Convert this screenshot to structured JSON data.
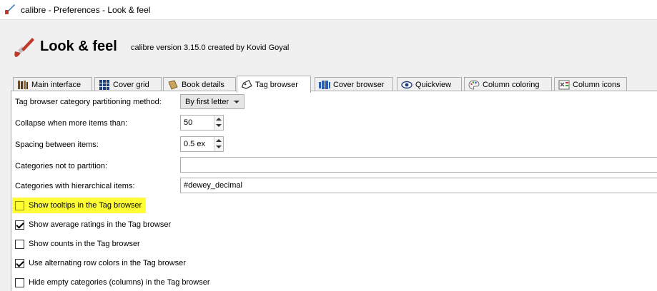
{
  "window": {
    "title": "calibre - Preferences - Look & feel"
  },
  "header": {
    "title": "Look & feel",
    "version": "calibre version 3.15.0 created by Kovid Goyal"
  },
  "tabs": [
    {
      "label": "Main interface",
      "icon": "books-icon",
      "active": false
    },
    {
      "label": "Cover grid",
      "icon": "grid-icon",
      "active": false
    },
    {
      "label": "Book details",
      "icon": "book-icon",
      "active": false
    },
    {
      "label": "Tag browser",
      "icon": "tag-icon",
      "active": true
    },
    {
      "label": "Cover browser",
      "icon": "cover-browser-icon",
      "active": false
    },
    {
      "label": "Quickview",
      "icon": "eye-icon",
      "active": false
    },
    {
      "label": "Column coloring",
      "icon": "palette-icon",
      "active": false
    },
    {
      "label": "Column icons",
      "icon": "column-icons-icon",
      "active": false
    }
  ],
  "settings": {
    "partition_label": "Tag browser category partitioning method:",
    "partition_value": "By first letter",
    "collapse_label": "Collapse when more items than:",
    "collapse_value": "50",
    "spacing_label": "Spacing between items:",
    "spacing_value": "0.5 ex",
    "not_partition_label": "Categories not to partition:",
    "not_partition_value": "",
    "hierarchical_label": "Categories with hierarchical items:",
    "hierarchical_value": "#dewey_decimal"
  },
  "checkboxes": [
    {
      "label": "Show tooltips in the Tag browser",
      "checked": false,
      "highlighted": true
    },
    {
      "label": "Show average ratings in the Tag browser",
      "checked": true,
      "highlighted": false
    },
    {
      "label": "Show counts in the Tag browser",
      "checked": false,
      "highlighted": false
    },
    {
      "label": "Use alternating row colors in the Tag browser",
      "checked": true,
      "highlighted": false
    },
    {
      "label": "Hide empty categories (columns) in the Tag browser",
      "checked": false,
      "highlighted": false
    }
  ],
  "colors": {
    "highlight": "#ffff33",
    "accent": "#0055aa"
  }
}
